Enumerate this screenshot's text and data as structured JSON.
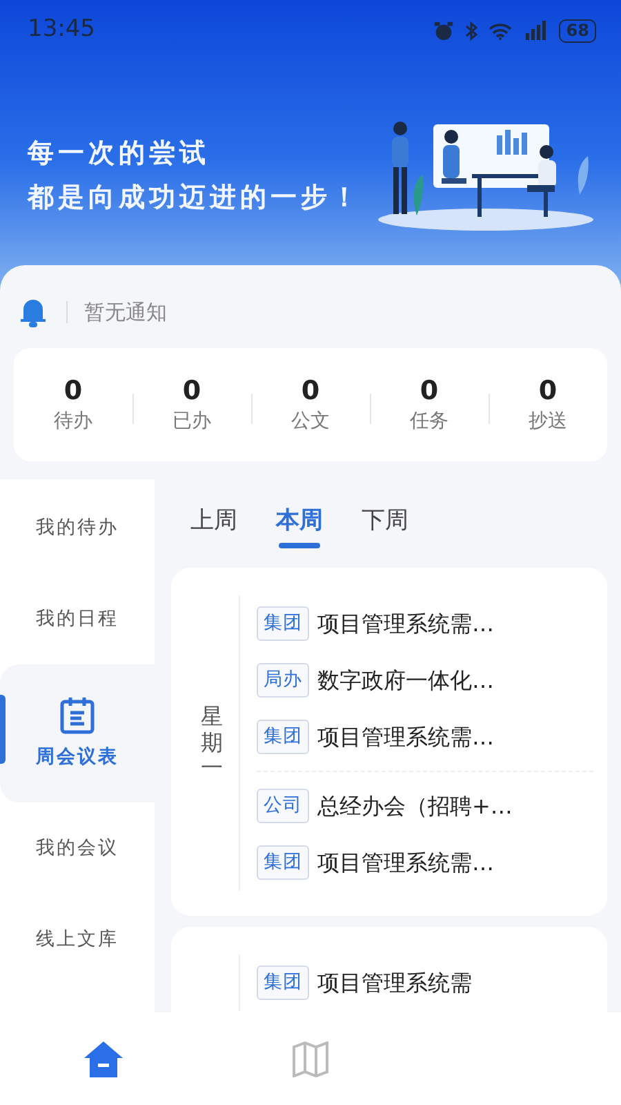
{
  "status_bar": {
    "time": "13:45",
    "battery": "68"
  },
  "banner": {
    "lines": [
      "每一次的尝试",
      "都是向成功迈进的一步！"
    ]
  },
  "notice": {
    "text": "暂无通知"
  },
  "stats": [
    {
      "value": "0",
      "label": "待办"
    },
    {
      "value": "0",
      "label": "已办"
    },
    {
      "value": "0",
      "label": "公文"
    },
    {
      "value": "0",
      "label": "任务"
    },
    {
      "value": "0",
      "label": "抄送"
    }
  ],
  "sidebar": {
    "items": [
      {
        "label": "我的待办",
        "selected": false
      },
      {
        "label": "我的日程",
        "selected": false
      },
      {
        "label": "周会议表",
        "selected": true
      },
      {
        "label": "我的会议",
        "selected": false
      },
      {
        "label": "线上文库",
        "selected": false
      }
    ]
  },
  "week_tabs": [
    {
      "label": "上周",
      "selected": false
    },
    {
      "label": "本周",
      "selected": true
    },
    {
      "label": "下周",
      "selected": false
    }
  ],
  "days": [
    {
      "day": "星期一",
      "groups": [
        [
          {
            "tag": "集团",
            "title": "项目管理系统需…"
          },
          {
            "tag": "局办",
            "title": "数字政府一体化…"
          },
          {
            "tag": "集团",
            "title": "项目管理系统需…"
          }
        ],
        [
          {
            "tag": "公司",
            "title": "总经办会（招聘+…"
          },
          {
            "tag": "集团",
            "title": "项目管理系统需…"
          }
        ]
      ]
    },
    {
      "groups": [
        [
          {
            "tag": "集团",
            "title": "项目管理系统需"
          }
        ]
      ]
    }
  ],
  "bottom_nav": [
    {
      "kind": "home",
      "selected": true
    },
    {
      "kind": "map",
      "selected": false
    }
  ]
}
